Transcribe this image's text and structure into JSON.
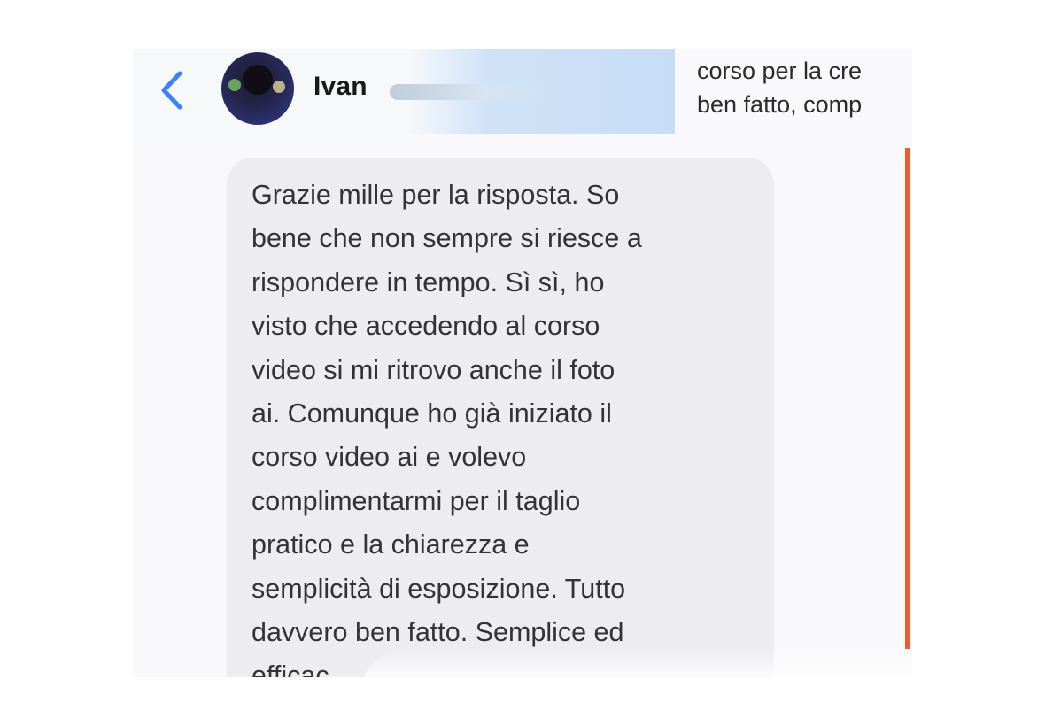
{
  "header": {
    "contact_name": "Ivan",
    "preview_lines": [
      "corso per la cre",
      "ben fatto, comp"
    ]
  },
  "message": {
    "lines": [
      "Grazie mille per la risposta. So",
      "bene che non sempre si riesce a",
      "rispondere in tempo. Sì sì, ho",
      "visto che accedendo al corso",
      "video si mi ritrovo anche il foto",
      "ai. Comunque ho già iniziato il",
      "corso video ai e volevo",
      "complimentarmi per il taglio",
      "pratico e la chiarezza e",
      "semplicità di esposizione. Tutto",
      "davvero ben fatto. Semplice ed",
      "efficac"
    ]
  },
  "colors": {
    "back_arrow": "#3b82f6",
    "accent_bar": "#ef5a2f",
    "bubble": "#ececf1"
  },
  "icons": {
    "back": "chevron-left-icon"
  }
}
